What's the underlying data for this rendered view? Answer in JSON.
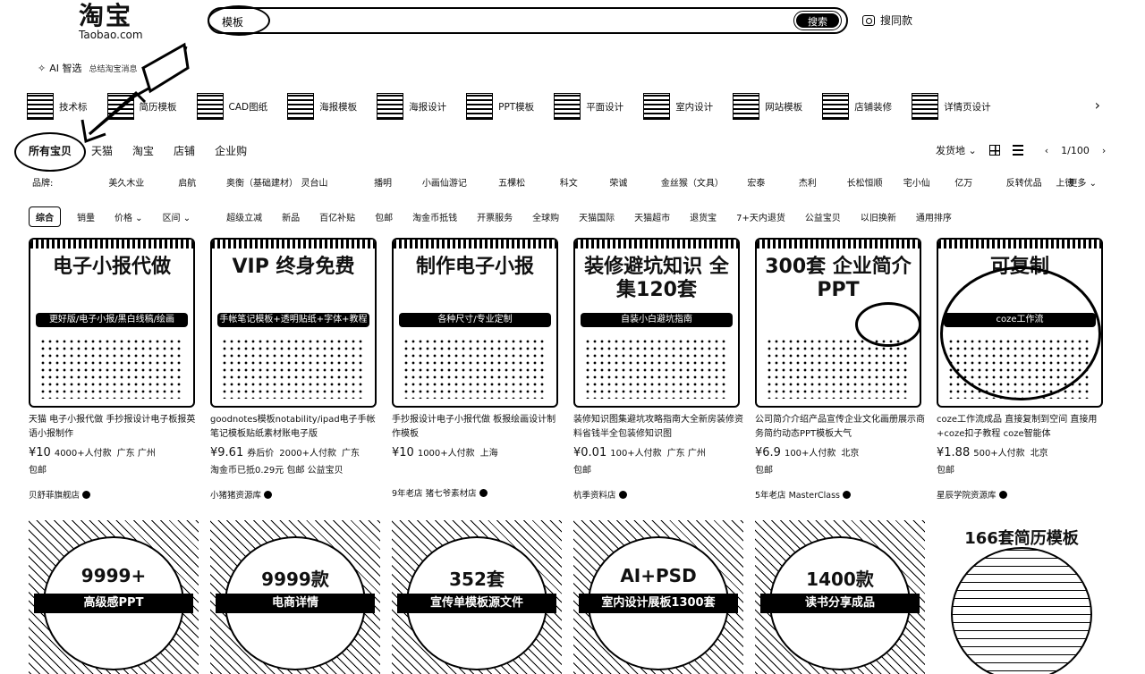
{
  "header": {
    "logo_cn": "淘宝",
    "logo_en": "Taobao.com",
    "search_value": "模板",
    "search_button": "搜索",
    "photo_search": "搜同款"
  },
  "ai": {
    "label": "AI 智选",
    "sub": "总结淘宝消息"
  },
  "categories": [
    {
      "label": "技术标"
    },
    {
      "label": "简历模板"
    },
    {
      "label": "CAD图纸"
    },
    {
      "label": "海报模板"
    },
    {
      "label": "海报设计"
    },
    {
      "label": "PPT模板"
    },
    {
      "label": "平面设计"
    },
    {
      "label": "室内设计"
    },
    {
      "label": "网站模板"
    },
    {
      "label": "店铺装修"
    },
    {
      "label": "详情页设计"
    }
  ],
  "tabs": [
    "所有宝贝",
    "天猫",
    "淘宝",
    "店铺",
    "企业购"
  ],
  "right_tools": {
    "ship_from": "发货地",
    "page": "1/100"
  },
  "brands": {
    "label": "品牌:",
    "items": [
      "美久木业",
      "启航",
      "奥衡（基础建材）",
      "灵台山",
      "播明",
      "小画仙游记",
      "五棵松",
      "科文",
      "荣诚",
      "金丝猴（文具）",
      "宏泰",
      "杰利",
      "长松恒顺",
      "宅小仙",
      "亿万",
      "反转优品",
      "上徳"
    ],
    "more": "更多"
  },
  "filters": {
    "sort": "综合",
    "sales": "销量",
    "price": "价格",
    "range": "区间",
    "items": [
      "超级立减",
      "新品",
      "百亿补贴",
      "包邮",
      "淘金币抵钱",
      "开票服务",
      "全球购",
      "天猫国际",
      "天猫超市",
      "退货宝",
      "7+天内退货",
      "公益宝贝",
      "以旧换新",
      "通用排序"
    ]
  },
  "products": [
    {
      "img_text": "电子小报代做",
      "img_sub": "更好版/电子小报/黑白线稿/绘画",
      "title": "天猫 电子小报代做 手抄报设计电子板报英语小报制作",
      "price": "¥10",
      "sales": "4000+人付款",
      "loc": "广东 广州",
      "ship": "包邮",
      "shop": "贝舒菲旗舰店"
    },
    {
      "img_text": "VIP 终身免费",
      "img_sub": "手帐笔记模板+透明贴纸+字体+教程",
      "title": "goodnotes模板notability/ipad电子手帐笔记模板贴纸素材账电子版",
      "price": "¥9.61",
      "price_suffix": "券后价",
      "sales": "2000+人付款",
      "loc": "广东",
      "ship": "淘金币已抵0.29元  包邮  公益宝贝",
      "shop": "小猪猪资源库"
    },
    {
      "img_text": "制作电子小报",
      "img_sub": "各种尺寸/专业定制",
      "title": "手抄报设计电子小报代做 板报绘画设计制作模板",
      "price": "¥10",
      "sales": "1000+人付款",
      "loc": "上海",
      "ship": "",
      "shop": "9年老店 猪七爷素材店"
    },
    {
      "img_text": "装修避坑知识 全集120套",
      "img_sub": "自装小白避坑指南",
      "title": "装修知识图集避坑攻略指南大全新房装修资料省钱半全包装修知识图",
      "price": "¥0.01",
      "sales": "100+人付款",
      "loc": "广东 广州",
      "ship": "包邮",
      "shop": "杭季资料店"
    },
    {
      "img_text": "300套 企业简介PPT",
      "img_sub": "",
      "title": "公司简介介绍产品宣传企业文化画册展示商务简约动态PPT模板大气",
      "price": "¥6.9",
      "sales": "100+人付款",
      "loc": "北京",
      "ship": "包邮",
      "shop": "5年老店 MasterClass"
    },
    {
      "img_text": "可复制",
      "img_sub": "coze工作流",
      "title": "coze工作流成品 直接复制到空间 直接用+coze扣子教程 coze智能体",
      "price": "¥1.88",
      "sales": "500+人付款",
      "loc": "北京",
      "ship": "包邮",
      "shop": "星辰学院资源库"
    }
  ],
  "row2": [
    {
      "a": "9999+",
      "b": "高级感PPT"
    },
    {
      "a": "9999款",
      "b": "电商详情"
    },
    {
      "a": "352套",
      "b": "宣传单模板源文件"
    },
    {
      "a": "AI+PSD",
      "b": "室内设计展板1300套"
    },
    {
      "a": "1400款",
      "b": "读书分享成品"
    },
    {
      "a": "166套简历模板",
      "b": ""
    }
  ]
}
